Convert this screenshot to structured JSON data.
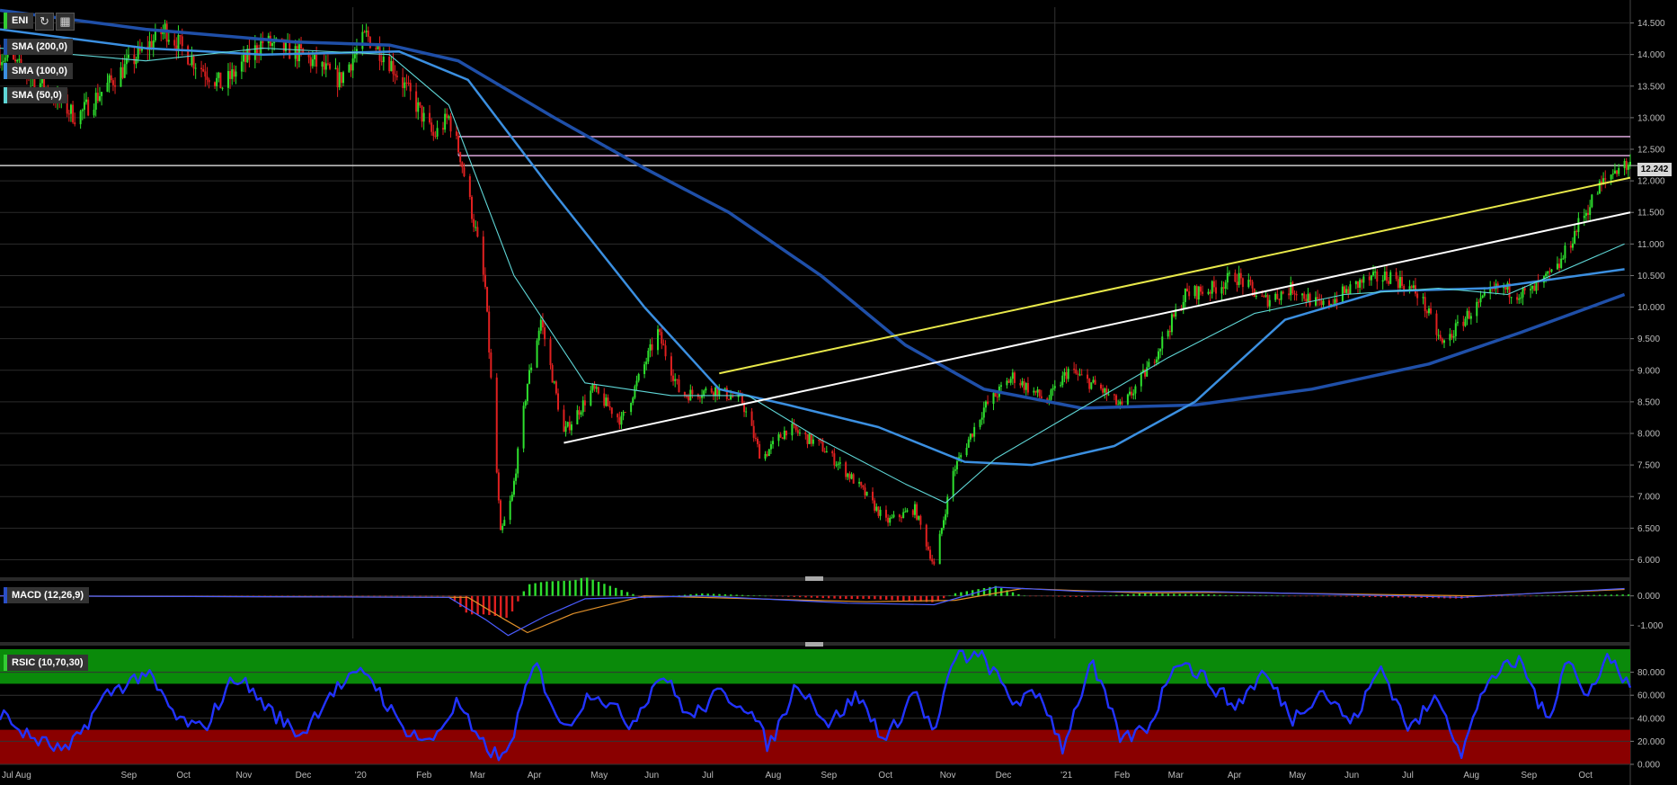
{
  "symbol_tag": {
    "label": "ENI",
    "accent": "#33cc33"
  },
  "toolbar": {
    "refresh_icon": "refresh-icon",
    "calendar_icon": "calendar-icon"
  },
  "overlays": [
    {
      "label": "SMA (200,0)",
      "color": "#1f4fa8"
    },
    {
      "label": "SMA (100,0)",
      "color": "#3b8fe0"
    },
    {
      "label": "SMA (50,0)",
      "color": "#5fd6d6"
    }
  ],
  "last_price_label": "12.242",
  "macd_panel": {
    "label": "MACD (12,26,9)",
    "color": "#2a4fc8",
    "y_ticks": [
      "0.000",
      "-1.000"
    ]
  },
  "rsi_panel": {
    "label": "RSIC (10,70,30)",
    "color": "#33cc33",
    "y_ticks": [
      "80.000",
      "60.000",
      "40.000",
      "20.000",
      "0.000"
    ]
  },
  "chart_data": [
    {
      "type": "candlestick",
      "title": "ENI",
      "ylim": [
        5.75,
        14.75
      ],
      "y_ticks": [
        "14.500",
        "14.000",
        "13.500",
        "13.000",
        "12.500",
        "12.000",
        "11.500",
        "11.000",
        "10.500",
        "10.000",
        "9.500",
        "9.000",
        "8.500",
        "8.000",
        "7.500",
        "7.000",
        "6.500",
        "6.000"
      ],
      "x_tick_labels": [
        "Jul",
        "Aug",
        "Sep",
        "Oct",
        "Nov",
        "Dec",
        "'20",
        "Feb",
        "Mar",
        "Apr",
        "May",
        "Jun",
        "Jul",
        "Aug",
        "Sep",
        "Oct",
        "Nov",
        "Dec",
        "'21",
        "Feb",
        "Mar",
        "Apr",
        "May",
        "Jun",
        "Jul",
        "Aug",
        "Sep",
        "Oct"
      ],
      "grid": true,
      "last_price": 12.242,
      "price_path": [
        {
          "x": "2019-07-01",
          "y": 14.0
        },
        {
          "x": "2019-07-20",
          "y": 13.6
        },
        {
          "x": "2019-08-10",
          "y": 13.0
        },
        {
          "x": "2019-09-01",
          "y": 13.7
        },
        {
          "x": "2019-09-25",
          "y": 14.4
        },
        {
          "x": "2019-10-10",
          "y": 13.9
        },
        {
          "x": "2019-10-25",
          "y": 13.5
        },
        {
          "x": "2019-11-15",
          "y": 14.2
        },
        {
          "x": "2019-12-05",
          "y": 14.0
        },
        {
          "x": "2019-12-25",
          "y": 13.6
        },
        {
          "x": "2020-01-08",
          "y": 14.3
        },
        {
          "x": "2020-01-20",
          "y": 13.9
        },
        {
          "x": "2020-02-03",
          "y": 13.2
        },
        {
          "x": "2020-02-12",
          "y": 12.7
        },
        {
          "x": "2020-02-20",
          "y": 13.0
        },
        {
          "x": "2020-02-26",
          "y": 12.4
        },
        {
          "x": "2020-03-05",
          "y": 11.2
        },
        {
          "x": "2020-03-10",
          "y": 10.3
        },
        {
          "x": "2020-03-18",
          "y": 6.4
        },
        {
          "x": "2020-03-24",
          "y": 7.0
        },
        {
          "x": "2020-04-01",
          "y": 8.8
        },
        {
          "x": "2020-04-08",
          "y": 9.8
        },
        {
          "x": "2020-04-20",
          "y": 8.0
        },
        {
          "x": "2020-05-05",
          "y": 8.7
        },
        {
          "x": "2020-05-20",
          "y": 8.2
        },
        {
          "x": "2020-06-08",
          "y": 9.6
        },
        {
          "x": "2020-06-20",
          "y": 8.6
        },
        {
          "x": "2020-07-08",
          "y": 8.7
        },
        {
          "x": "2020-07-22",
          "y": 8.5
        },
        {
          "x": "2020-08-01",
          "y": 7.6
        },
        {
          "x": "2020-08-15",
          "y": 8.1
        },
        {
          "x": "2020-09-01",
          "y": 7.8
        },
        {
          "x": "2020-09-20",
          "y": 7.2
        },
        {
          "x": "2020-10-05",
          "y": 6.6
        },
        {
          "x": "2020-10-20",
          "y": 6.8
        },
        {
          "x": "2020-10-30",
          "y": 5.9
        },
        {
          "x": "2020-11-09",
          "y": 7.4
        },
        {
          "x": "2020-11-25",
          "y": 8.4
        },
        {
          "x": "2020-12-10",
          "y": 8.9
        },
        {
          "x": "2020-12-28",
          "y": 8.5
        },
        {
          "x": "2021-01-08",
          "y": 9.0
        },
        {
          "x": "2021-01-25",
          "y": 8.7
        },
        {
          "x": "2021-02-05",
          "y": 8.4
        },
        {
          "x": "2021-02-20",
          "y": 9.1
        },
        {
          "x": "2021-03-10",
          "y": 10.2
        },
        {
          "x": "2021-03-25",
          "y": 10.3
        },
        {
          "x": "2021-04-05",
          "y": 10.5
        },
        {
          "x": "2021-04-20",
          "y": 10.1
        },
        {
          "x": "2021-05-05",
          "y": 10.3
        },
        {
          "x": "2021-05-20",
          "y": 10.0
        },
        {
          "x": "2021-06-10",
          "y": 10.4
        },
        {
          "x": "2021-06-25",
          "y": 10.5
        },
        {
          "x": "2021-07-10",
          "y": 10.2
        },
        {
          "x": "2021-07-22",
          "y": 9.4
        },
        {
          "x": "2021-08-05",
          "y": 9.9
        },
        {
          "x": "2021-08-20",
          "y": 10.3
        },
        {
          "x": "2021-09-05",
          "y": 10.2
        },
        {
          "x": "2021-09-20",
          "y": 10.6
        },
        {
          "x": "2021-10-01",
          "y": 11.3
        },
        {
          "x": "2021-10-12",
          "y": 11.9
        },
        {
          "x": "2021-10-22",
          "y": 12.24
        }
      ],
      "sma_200": [
        {
          "x": "2019-07-01",
          "y": 14.7
        },
        {
          "x": "2019-09-15",
          "y": 14.4
        },
        {
          "x": "2019-12-01",
          "y": 14.2
        },
        {
          "x": "2020-01-20",
          "y": 14.15
        },
        {
          "x": "2020-02-25",
          "y": 13.9
        },
        {
          "x": "2020-04-15",
          "y": 13.0
        },
        {
          "x": "2020-06-01",
          "y": 12.2
        },
        {
          "x": "2020-07-15",
          "y": 11.5
        },
        {
          "x": "2020-09-01",
          "y": 10.5
        },
        {
          "x": "2020-10-15",
          "y": 9.4
        },
        {
          "x": "2020-11-25",
          "y": 8.7
        },
        {
          "x": "2021-01-15",
          "y": 8.4
        },
        {
          "x": "2021-03-15",
          "y": 8.45
        },
        {
          "x": "2021-05-15",
          "y": 8.7
        },
        {
          "x": "2021-07-15",
          "y": 9.1
        },
        {
          "x": "2021-09-01",
          "y": 9.6
        },
        {
          "x": "2021-10-25",
          "y": 10.2
        }
      ],
      "sma_100": [
        {
          "x": "2019-07-01",
          "y": 14.4
        },
        {
          "x": "2019-09-15",
          "y": 14.1
        },
        {
          "x": "2019-11-15",
          "y": 14.0
        },
        {
          "x": "2020-01-25",
          "y": 14.05
        },
        {
          "x": "2020-03-01",
          "y": 13.6
        },
        {
          "x": "2020-04-15",
          "y": 11.8
        },
        {
          "x": "2020-06-01",
          "y": 10.0
        },
        {
          "x": "2020-07-10",
          "y": 8.7
        },
        {
          "x": "2020-08-15",
          "y": 8.45
        },
        {
          "x": "2020-10-01",
          "y": 8.1
        },
        {
          "x": "2020-11-15",
          "y": 7.55
        },
        {
          "x": "2020-12-20",
          "y": 7.5
        },
        {
          "x": "2021-02-01",
          "y": 7.8
        },
        {
          "x": "2021-03-15",
          "y": 8.5
        },
        {
          "x": "2021-05-01",
          "y": 9.8
        },
        {
          "x": "2021-06-20",
          "y": 10.25
        },
        {
          "x": "2021-08-15",
          "y": 10.3
        },
        {
          "x": "2021-10-25",
          "y": 10.6
        }
      ],
      "sma_50": [
        {
          "x": "2019-07-01",
          "y": 14.1
        },
        {
          "x": "2019-09-15",
          "y": 13.9
        },
        {
          "x": "2019-11-15",
          "y": 14.1
        },
        {
          "x": "2020-01-20",
          "y": 14.0
        },
        {
          "x": "2020-02-20",
          "y": 13.2
        },
        {
          "x": "2020-03-25",
          "y": 10.5
        },
        {
          "x": "2020-05-01",
          "y": 8.8
        },
        {
          "x": "2020-06-15",
          "y": 8.6
        },
        {
          "x": "2020-07-25",
          "y": 8.6
        },
        {
          "x": "2020-09-01",
          "y": 7.9
        },
        {
          "x": "2020-10-15",
          "y": 7.2
        },
        {
          "x": "2020-11-05",
          "y": 6.9
        },
        {
          "x": "2020-12-01",
          "y": 7.6
        },
        {
          "x": "2021-01-15",
          "y": 8.4
        },
        {
          "x": "2021-03-01",
          "y": 9.2
        },
        {
          "x": "2021-04-15",
          "y": 9.9
        },
        {
          "x": "2021-06-01",
          "y": 10.2
        },
        {
          "x": "2021-07-20",
          "y": 10.3
        },
        {
          "x": "2021-08-25",
          "y": 10.2
        },
        {
          "x": "2021-10-25",
          "y": 11.0
        }
      ],
      "trend_lines": [
        {
          "color": "#ffffff",
          "start": {
            "x": "2020-04-20",
            "y": 7.85
          },
          "end": {
            "x": "2021-10-28",
            "y": 11.5
          }
        },
        {
          "color": "#e8e84a",
          "start": {
            "x": "2020-07-10",
            "y": 8.95
          },
          "end": {
            "x": "2021-10-28",
            "y": 12.05
          }
        }
      ],
      "horizontal_lines": [
        {
          "color": "#f0b8f0",
          "y": 12.7,
          "from": "2020-02-25"
        },
        {
          "color": "#f0b8f0",
          "y": 12.4,
          "from": "2020-02-25"
        },
        {
          "color": "#cccccc",
          "y": 12.242,
          "from": "2019-07-01"
        }
      ]
    },
    {
      "type": "line",
      "title": "MACD (12,26,9)",
      "ylim": [
        -1.45,
        0.45
      ],
      "y_ticks": [
        "0.000",
        "-1.000"
      ],
      "macd": [
        {
          "x": "2019-07-01",
          "y": 0.0
        },
        {
          "x": "2020-02-20",
          "y": -0.05
        },
        {
          "x": "2020-03-10",
          "y": -0.8
        },
        {
          "x": "2020-03-22",
          "y": -1.35
        },
        {
          "x": "2020-04-10",
          "y": -0.7
        },
        {
          "x": "2020-05-01",
          "y": -0.1
        },
        {
          "x": "2020-07-01",
          "y": 0.0
        },
        {
          "x": "2020-09-15",
          "y": -0.25
        },
        {
          "x": "2020-10-30",
          "y": -0.3
        },
        {
          "x": "2020-12-01",
          "y": 0.3
        },
        {
          "x": "2021-01-15",
          "y": 0.15
        },
        {
          "x": "2021-03-20",
          "y": 0.15
        },
        {
          "x": "2021-06-01",
          "y": 0.05
        },
        {
          "x": "2021-08-01",
          "y": -0.05
        },
        {
          "x": "2021-10-25",
          "y": 0.25
        }
      ],
      "signal": [
        {
          "x": "2019-07-01",
          "y": 0.0
        },
        {
          "x": "2020-03-01",
          "y": -0.05
        },
        {
          "x": "2020-03-20",
          "y": -0.8
        },
        {
          "x": "2020-04-01",
          "y": -1.25
        },
        {
          "x": "2020-04-25",
          "y": -0.6
        },
        {
          "x": "2020-06-01",
          "y": 0.0
        },
        {
          "x": "2020-09-25",
          "y": -0.2
        },
        {
          "x": "2020-11-10",
          "y": -0.15
        },
        {
          "x": "2020-12-15",
          "y": 0.25
        },
        {
          "x": "2021-02-15",
          "y": 0.1
        },
        {
          "x": "2021-04-01",
          "y": 0.12
        },
        {
          "x": "2021-08-10",
          "y": 0.0
        },
        {
          "x": "2021-10-25",
          "y": 0.22
        }
      ]
    },
    {
      "type": "line",
      "title": "RSIC (10,70,30)",
      "ylim": [
        0,
        100
      ],
      "y_ticks": [
        "80.000",
        "60.000",
        "40.000",
        "20.000",
        "0.000"
      ],
      "overbought": 70,
      "oversold": 30,
      "rsi": [
        {
          "x": "2019-07-01",
          "y": 45
        },
        {
          "x": "2019-07-15",
          "y": 25
        },
        {
          "x": "2019-08-05",
          "y": 10
        },
        {
          "x": "2019-08-25",
          "y": 60
        },
        {
          "x": "2019-09-15",
          "y": 80
        },
        {
          "x": "2019-10-01",
          "y": 40
        },
        {
          "x": "2019-10-15",
          "y": 30
        },
        {
          "x": "2019-11-01",
          "y": 78
        },
        {
          "x": "2019-11-20",
          "y": 45
        },
        {
          "x": "2019-12-05",
          "y": 25
        },
        {
          "x": "2019-12-20",
          "y": 62
        },
        {
          "x": "2020-01-08",
          "y": 82
        },
        {
          "x": "2020-01-25",
          "y": 35
        },
        {
          "x": "2020-02-10",
          "y": 18
        },
        {
          "x": "2020-02-25",
          "y": 55
        },
        {
          "x": "2020-03-05",
          "y": 22
        },
        {
          "x": "2020-03-20",
          "y": 3
        },
        {
          "x": "2020-04-05",
          "y": 88
        },
        {
          "x": "2020-04-20",
          "y": 30
        },
        {
          "x": "2020-05-05",
          "y": 65
        },
        {
          "x": "2020-05-25",
          "y": 35
        },
        {
          "x": "2020-06-10",
          "y": 80
        },
        {
          "x": "2020-06-25",
          "y": 40
        },
        {
          "x": "2020-07-10",
          "y": 62
        },
        {
          "x": "2020-07-25",
          "y": 50
        },
        {
          "x": "2020-08-05",
          "y": 15
        },
        {
          "x": "2020-08-20",
          "y": 72
        },
        {
          "x": "2020-09-05",
          "y": 35
        },
        {
          "x": "2020-09-20",
          "y": 60
        },
        {
          "x": "2020-10-05",
          "y": 20
        },
        {
          "x": "2020-10-20",
          "y": 65
        },
        {
          "x": "2020-10-30",
          "y": 25
        },
        {
          "x": "2020-11-10",
          "y": 95
        },
        {
          "x": "2020-11-25",
          "y": 92
        },
        {
          "x": "2020-12-10",
          "y": 55
        },
        {
          "x": "2020-12-25",
          "y": 60
        },
        {
          "x": "2021-01-05",
          "y": 15
        },
        {
          "x": "2021-01-20",
          "y": 88
        },
        {
          "x": "2021-02-05",
          "y": 20
        },
        {
          "x": "2021-02-20",
          "y": 35
        },
        {
          "x": "2021-03-05",
          "y": 93
        },
        {
          "x": "2021-03-20",
          "y": 75
        },
        {
          "x": "2021-04-05",
          "y": 50
        },
        {
          "x": "2021-04-20",
          "y": 80
        },
        {
          "x": "2021-05-05",
          "y": 40
        },
        {
          "x": "2021-05-20",
          "y": 65
        },
        {
          "x": "2021-06-05",
          "y": 35
        },
        {
          "x": "2021-06-20",
          "y": 85
        },
        {
          "x": "2021-07-05",
          "y": 30
        },
        {
          "x": "2021-07-20",
          "y": 60
        },
        {
          "x": "2021-08-01",
          "y": 10
        },
        {
          "x": "2021-08-15",
          "y": 75
        },
        {
          "x": "2021-09-01",
          "y": 90
        },
        {
          "x": "2021-09-15",
          "y": 35
        },
        {
          "x": "2021-09-25",
          "y": 97
        },
        {
          "x": "2021-10-05",
          "y": 55
        },
        {
          "x": "2021-10-15",
          "y": 95
        },
        {
          "x": "2021-10-28",
          "y": 70
        }
      ]
    }
  ]
}
